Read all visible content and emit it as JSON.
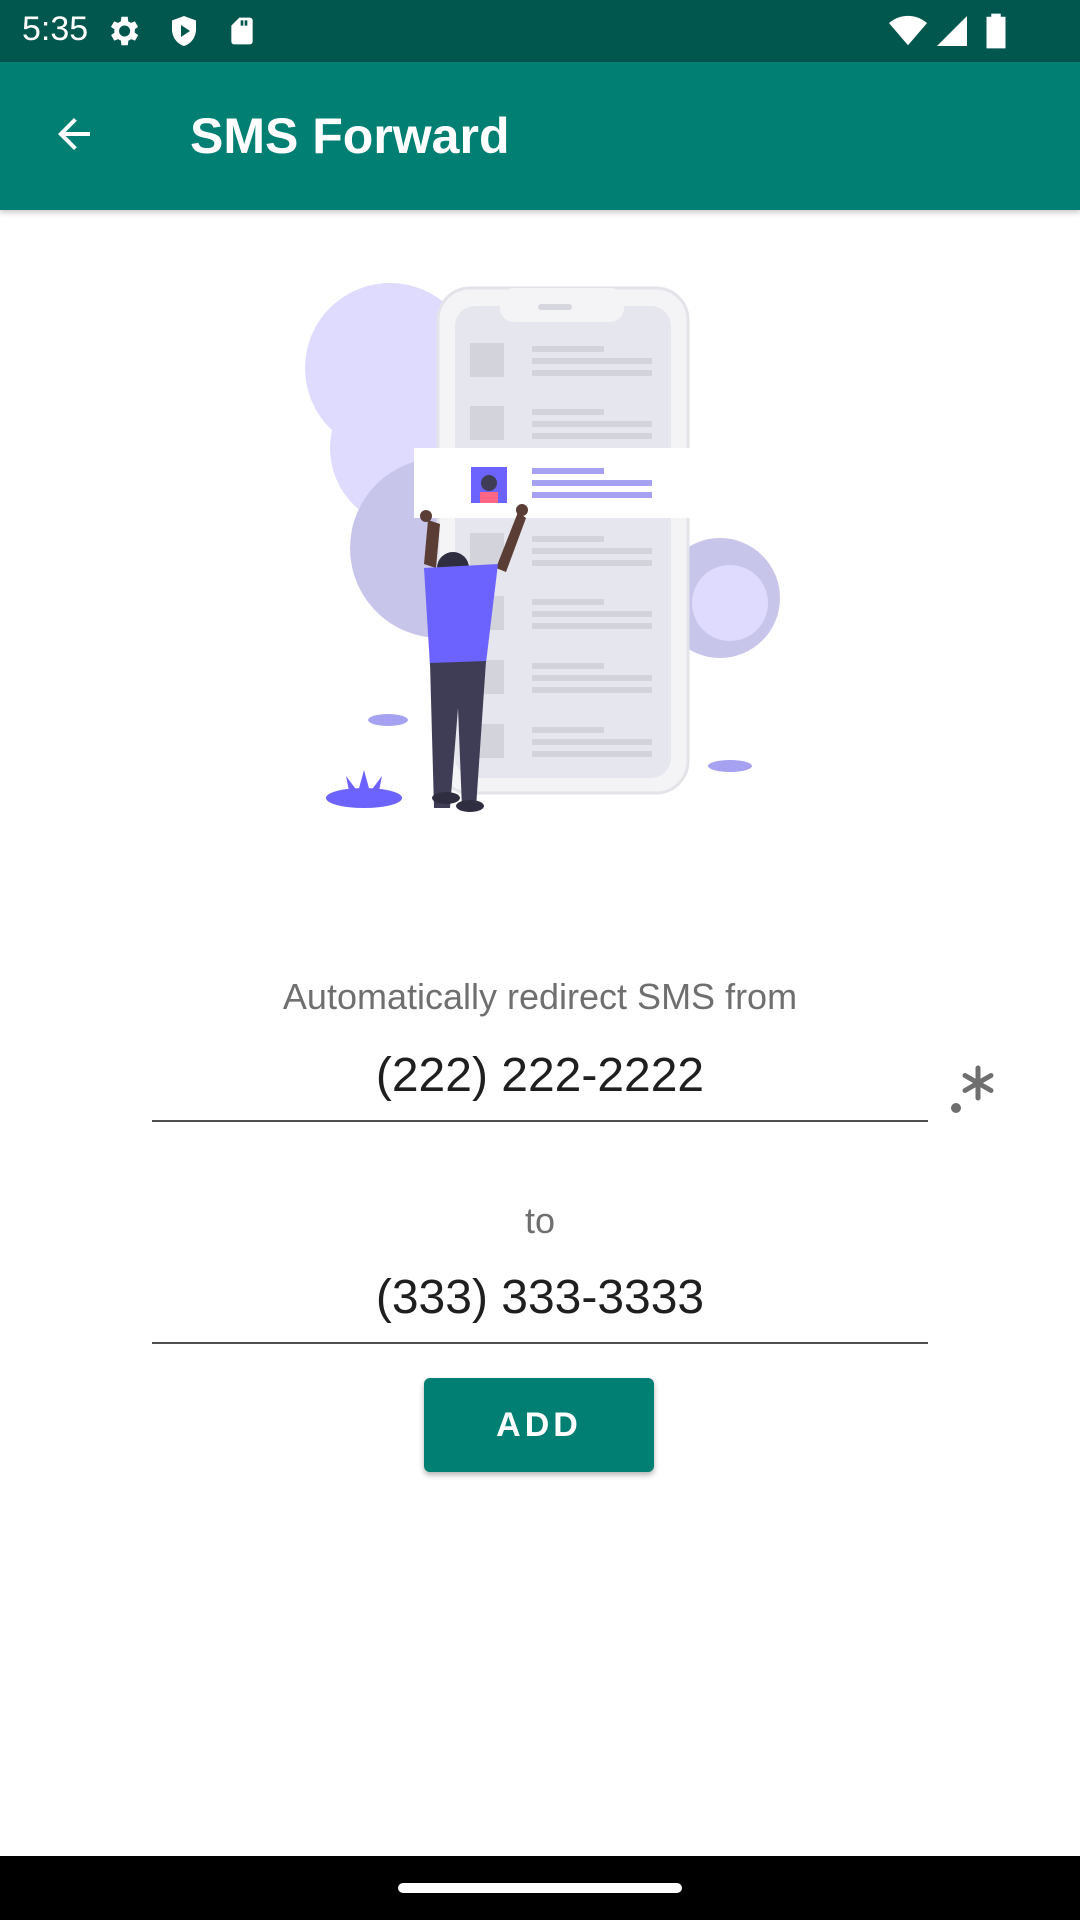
{
  "status_bar": {
    "time": "5:35",
    "icons": [
      "settings-icon",
      "shield-icon",
      "sd-card-icon",
      "wifi-icon",
      "signal-icon",
      "battery-icon"
    ]
  },
  "app_bar": {
    "title": "SMS Forward",
    "back_icon": "arrow-back-icon",
    "color": "#017f72"
  },
  "form": {
    "from_label": "Automatically redirect SMS from",
    "from_value": "(222) 222-2222",
    "to_label": "to",
    "to_value": "(333) 333-3333",
    "regex_icon": "regex-icon",
    "add_label": "ADD"
  },
  "colors": {
    "status_bar": "#01574d",
    "accent": "#017f72",
    "illustration_accent": "#6c63ff"
  }
}
